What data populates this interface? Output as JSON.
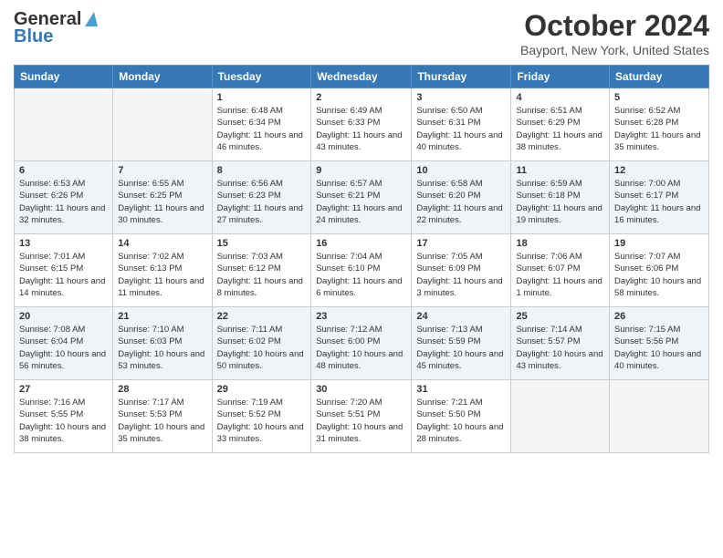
{
  "header": {
    "logo_line1": "General",
    "logo_line2": "Blue",
    "month_title": "October 2024",
    "location": "Bayport, New York, United States"
  },
  "weekdays": [
    "Sunday",
    "Monday",
    "Tuesday",
    "Wednesday",
    "Thursday",
    "Friday",
    "Saturday"
  ],
  "weeks": [
    [
      {
        "num": "",
        "info": ""
      },
      {
        "num": "",
        "info": ""
      },
      {
        "num": "1",
        "info": "Sunrise: 6:48 AM\nSunset: 6:34 PM\nDaylight: 11 hours and 46 minutes."
      },
      {
        "num": "2",
        "info": "Sunrise: 6:49 AM\nSunset: 6:33 PM\nDaylight: 11 hours and 43 minutes."
      },
      {
        "num": "3",
        "info": "Sunrise: 6:50 AM\nSunset: 6:31 PM\nDaylight: 11 hours and 40 minutes."
      },
      {
        "num": "4",
        "info": "Sunrise: 6:51 AM\nSunset: 6:29 PM\nDaylight: 11 hours and 38 minutes."
      },
      {
        "num": "5",
        "info": "Sunrise: 6:52 AM\nSunset: 6:28 PM\nDaylight: 11 hours and 35 minutes."
      }
    ],
    [
      {
        "num": "6",
        "info": "Sunrise: 6:53 AM\nSunset: 6:26 PM\nDaylight: 11 hours and 32 minutes."
      },
      {
        "num": "7",
        "info": "Sunrise: 6:55 AM\nSunset: 6:25 PM\nDaylight: 11 hours and 30 minutes."
      },
      {
        "num": "8",
        "info": "Sunrise: 6:56 AM\nSunset: 6:23 PM\nDaylight: 11 hours and 27 minutes."
      },
      {
        "num": "9",
        "info": "Sunrise: 6:57 AM\nSunset: 6:21 PM\nDaylight: 11 hours and 24 minutes."
      },
      {
        "num": "10",
        "info": "Sunrise: 6:58 AM\nSunset: 6:20 PM\nDaylight: 11 hours and 22 minutes."
      },
      {
        "num": "11",
        "info": "Sunrise: 6:59 AM\nSunset: 6:18 PM\nDaylight: 11 hours and 19 minutes."
      },
      {
        "num": "12",
        "info": "Sunrise: 7:00 AM\nSunset: 6:17 PM\nDaylight: 11 hours and 16 minutes."
      }
    ],
    [
      {
        "num": "13",
        "info": "Sunrise: 7:01 AM\nSunset: 6:15 PM\nDaylight: 11 hours and 14 minutes."
      },
      {
        "num": "14",
        "info": "Sunrise: 7:02 AM\nSunset: 6:13 PM\nDaylight: 11 hours and 11 minutes."
      },
      {
        "num": "15",
        "info": "Sunrise: 7:03 AM\nSunset: 6:12 PM\nDaylight: 11 hours and 8 minutes."
      },
      {
        "num": "16",
        "info": "Sunrise: 7:04 AM\nSunset: 6:10 PM\nDaylight: 11 hours and 6 minutes."
      },
      {
        "num": "17",
        "info": "Sunrise: 7:05 AM\nSunset: 6:09 PM\nDaylight: 11 hours and 3 minutes."
      },
      {
        "num": "18",
        "info": "Sunrise: 7:06 AM\nSunset: 6:07 PM\nDaylight: 11 hours and 1 minute."
      },
      {
        "num": "19",
        "info": "Sunrise: 7:07 AM\nSunset: 6:06 PM\nDaylight: 10 hours and 58 minutes."
      }
    ],
    [
      {
        "num": "20",
        "info": "Sunrise: 7:08 AM\nSunset: 6:04 PM\nDaylight: 10 hours and 56 minutes."
      },
      {
        "num": "21",
        "info": "Sunrise: 7:10 AM\nSunset: 6:03 PM\nDaylight: 10 hours and 53 minutes."
      },
      {
        "num": "22",
        "info": "Sunrise: 7:11 AM\nSunset: 6:02 PM\nDaylight: 10 hours and 50 minutes."
      },
      {
        "num": "23",
        "info": "Sunrise: 7:12 AM\nSunset: 6:00 PM\nDaylight: 10 hours and 48 minutes."
      },
      {
        "num": "24",
        "info": "Sunrise: 7:13 AM\nSunset: 5:59 PM\nDaylight: 10 hours and 45 minutes."
      },
      {
        "num": "25",
        "info": "Sunrise: 7:14 AM\nSunset: 5:57 PM\nDaylight: 10 hours and 43 minutes."
      },
      {
        "num": "26",
        "info": "Sunrise: 7:15 AM\nSunset: 5:56 PM\nDaylight: 10 hours and 40 minutes."
      }
    ],
    [
      {
        "num": "27",
        "info": "Sunrise: 7:16 AM\nSunset: 5:55 PM\nDaylight: 10 hours and 38 minutes."
      },
      {
        "num": "28",
        "info": "Sunrise: 7:17 AM\nSunset: 5:53 PM\nDaylight: 10 hours and 35 minutes."
      },
      {
        "num": "29",
        "info": "Sunrise: 7:19 AM\nSunset: 5:52 PM\nDaylight: 10 hours and 33 minutes."
      },
      {
        "num": "30",
        "info": "Sunrise: 7:20 AM\nSunset: 5:51 PM\nDaylight: 10 hours and 31 minutes."
      },
      {
        "num": "31",
        "info": "Sunrise: 7:21 AM\nSunset: 5:50 PM\nDaylight: 10 hours and 28 minutes."
      },
      {
        "num": "",
        "info": ""
      },
      {
        "num": "",
        "info": ""
      }
    ]
  ]
}
